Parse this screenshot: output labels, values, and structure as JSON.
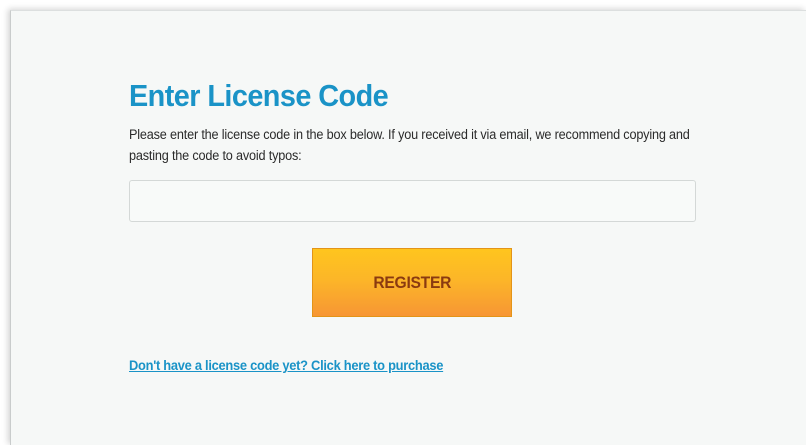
{
  "dialog": {
    "title": "Enter License Code",
    "instructions": "Please enter the license code in the box below. If you received it via email, we recommend copying and pasting the code to avoid typos:",
    "license_input": {
      "value": "",
      "placeholder": ""
    },
    "register_label": "REGISTER",
    "purchase_link": "Don't have a license code yet? Click here to purchase"
  },
  "colors": {
    "title": "#1a93c7",
    "link": "#1a93c7",
    "button_top": "#ffc51e",
    "button_bottom": "#f79634",
    "button_text": "#8a3a10",
    "background": "#f6f8f7"
  }
}
